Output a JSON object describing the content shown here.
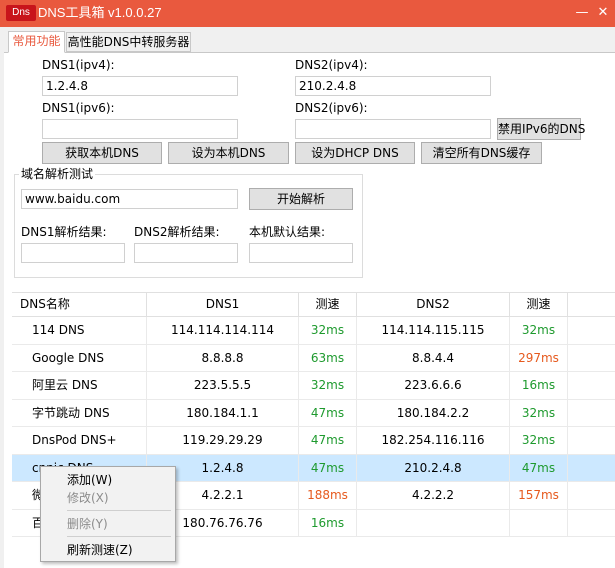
{
  "window": {
    "icon_text": "Dns",
    "title": "DNS工具箱 v1.0.0.27",
    "minimize": "—",
    "close": "✕"
  },
  "tabs": [
    {
      "label": "常用功能",
      "active": true
    },
    {
      "label": "高性能DNS中转服务器",
      "active": false
    }
  ],
  "dns_settings": {
    "dns1_ipv4_label": "DNS1(ipv4):",
    "dns1_ipv4_value": "1.2.4.8",
    "dns2_ipv4_label": "DNS2(ipv4):",
    "dns2_ipv4_value": "210.2.4.8",
    "dns1_ipv6_label": "DNS1(ipv6):",
    "dns1_ipv6_value": "",
    "dns2_ipv6_label": "DNS2(ipv6):",
    "dns2_ipv6_value": "",
    "disable_ipv6_button": "禁用IPv6的DNS",
    "get_local_button": "获取本机DNS",
    "set_local_button": "设为本机DNS",
    "set_dhcp_button": "设为DHCP DNS",
    "flush_button": "清空所有DNS缓存"
  },
  "resolve_test": {
    "group_title": "域名解析测试",
    "domain_value": "www.baidu.com",
    "start_button": "开始解析",
    "dns1_result_label": "DNS1解析结果:",
    "dns1_result_value": "",
    "dns2_result_label": "DNS2解析结果:",
    "dns2_result_value": "",
    "local_result_label": "本机默认结果:",
    "local_result_value": ""
  },
  "table": {
    "headers": [
      "DNS名称",
      "DNS1",
      "测速",
      "DNS2",
      "测速"
    ],
    "rows": [
      {
        "name": "114 DNS",
        "dns1": "114.114.114.114",
        "speed1": "32ms",
        "dns2": "114.114.115.115",
        "speed2": "32ms"
      },
      {
        "name": "Google DNS",
        "dns1": "8.8.8.8",
        "speed1": "63ms",
        "dns2": "8.8.4.4",
        "speed2": "297ms"
      },
      {
        "name": "阿里云 DNS",
        "dns1": "223.5.5.5",
        "speed1": "32ms",
        "dns2": "223.6.6.6",
        "speed2": "16ms"
      },
      {
        "name": "字节跳动 DNS",
        "dns1": "180.184.1.1",
        "speed1": "47ms",
        "dns2": "180.184.2.2",
        "speed2": "32ms"
      },
      {
        "name": "DnsPod DNS+",
        "dns1": "119.29.29.29",
        "speed1": "47ms",
        "dns2": "182.254.116.116",
        "speed2": "32ms"
      },
      {
        "name": "cnnic DNS",
        "dns1": "1.2.4.8",
        "speed1": "47ms",
        "dns2": "210.2.4.8",
        "speed2": "47ms"
      },
      {
        "name": "微",
        "dns1": "4.2.2.1",
        "speed1": "188ms",
        "dns2": "4.2.2.2",
        "speed2": "157ms"
      },
      {
        "name": "百",
        "dns1": "180.76.76.76",
        "speed1": "16ms",
        "dns2": "",
        "speed2": ""
      }
    ],
    "selected_row": 5
  },
  "context_menu": {
    "add": "添加(W)",
    "edit": "修改(X)",
    "delete": "删除(Y)",
    "refresh": "刷新测速(Z)"
  },
  "colors": {
    "title_bar": "#e9593e",
    "fast": "#1e9a2e",
    "slow": "#e65a1e",
    "selected_row": "#cce8ff"
  }
}
